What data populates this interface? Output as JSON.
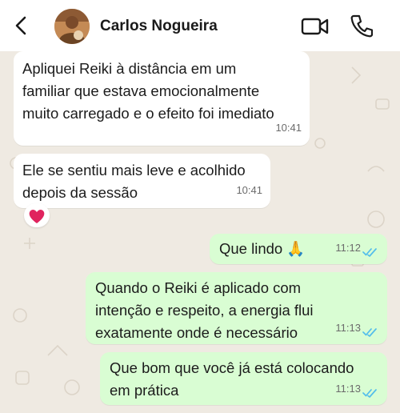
{
  "header": {
    "contact_name": "Carlos Nogueira"
  },
  "messages": [
    {
      "direction": "in",
      "lines": [
        "Apliquei Reiki à distância em um",
        "familiar que estava emocionalmente",
        "muito carregado e o efeito foi imediato"
      ],
      "time": "10:41"
    },
    {
      "direction": "in",
      "lines": [
        "Ele se sentiu mais leve e acolhido",
        "depois da sessão"
      ],
      "time": "10:41",
      "reaction": "heart"
    },
    {
      "direction": "out",
      "lines": [
        "Que lindo 🙏"
      ],
      "time": "11:12",
      "status": "read"
    },
    {
      "direction": "out",
      "lines": [
        "Quando o Reiki é aplicado com",
        "intenção e respeito, a energia flui",
        "exatamente onde é necessário"
      ],
      "time": "11:13",
      "status": "read"
    },
    {
      "direction": "out",
      "lines": [
        "Que bom que você já está colocando",
        "em prática"
      ],
      "time": "11:13",
      "status": "read"
    }
  ],
  "colors": {
    "incoming": "#ffffff",
    "outgoing": "#d9fdd3",
    "read_ticks": "#53bdeb",
    "heart": "#e0245e"
  }
}
